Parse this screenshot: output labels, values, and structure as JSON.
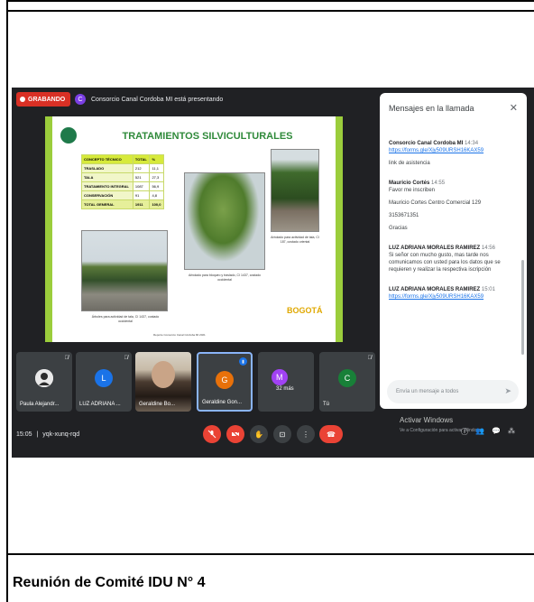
{
  "caption": "Reunión de Comité IDU N° 4",
  "meet": {
    "recording_label": "GRABANDO",
    "presenter_initial": "C",
    "presenting_text": "Consorcio Canal Cordoba MI está presentando",
    "meeting_time": "15:05",
    "meeting_code": "yqk-xunq-rqd",
    "windows_activate": "Activar Windows",
    "windows_activate_sub": "Ve a Configuración para activar Windows."
  },
  "slide": {
    "title": "TRATAMIENTOS SILVICULTURALES",
    "table_headers": [
      "CONCEPTO TÉCNICO",
      "TOTAL",
      "%"
    ],
    "rows": [
      {
        "concept": "TRASLADO",
        "total": "212",
        "pct": "11,1"
      },
      {
        "concept": "TALA",
        "total": "521",
        "pct": "27,3"
      },
      {
        "concept": "TRATAMIENTO INTEGRAL",
        "total": "1087",
        "pct": "56,9"
      },
      {
        "concept": "CONSERVACIÓN",
        "total": "91",
        "pct": "4,8"
      },
      {
        "concept": "TOTAL GENERAL",
        "total": "1911",
        "pct": "100,0"
      }
    ],
    "caption1": "Árboles para actividad de tala, CI 1437, costado occidental",
    "caption2": "Arbolado para bloqueo y traslado, CI 1437, costado occidental",
    "caption3": "Arbolado para actividad de tala, CI 187, costado oriental",
    "logo_text": "BOGOTÁ",
    "footer": "Reporte Consorcio Canal Córdoba MI 2021"
  },
  "chat": {
    "title": "Mensajes en la llamada",
    "messages": [
      {
        "sender": "Consorcio Canal Cordoba MI",
        "time": "14:34",
        "lines": [
          "https://forms.gle/Xjy509URSH16KAX59",
          "link de asistencia"
        ],
        "link_first": true
      },
      {
        "sender": "Mauricio Cortés",
        "time": "14:55",
        "lines": [
          "Favor me inscriben",
          "Mauricio Cortes Centro Comercial 129",
          "3153671351",
          "Gracias"
        ],
        "link_first": false
      },
      {
        "sender": "LUZ ADRIANA MORALES RAMIREZ",
        "time": "14:56",
        "lines": [
          "Si señor con mucho gusto, mas tarde nos comunicamos con usted para los datos que se requieren y realizar la respectiva iscripción"
        ],
        "link_first": false
      },
      {
        "sender": "LUZ ADRIANA MORALES RAMIREZ",
        "time": "15:01",
        "lines": [
          "https://forms.gle/Xjy509URSH16KAX59"
        ],
        "link_first": true
      }
    ],
    "input_placeholder": "Envía un mensaje a todos"
  },
  "participants": [
    {
      "name": "Paula Alejandr...",
      "initial": "",
      "color": "#f2f2f2",
      "type": "avatar-img"
    },
    {
      "name": "LUZ ADRIANA ...",
      "initial": "L",
      "color": "#1a73e8",
      "type": "initial"
    },
    {
      "name": "Geraldine Bo...",
      "initial": "",
      "color": "",
      "type": "photo"
    },
    {
      "name": "Geraldine Gon...",
      "initial": "G",
      "color": "#e8710a",
      "type": "initial"
    },
    {
      "name": "32 más",
      "initial": "M",
      "color": "#a142f4",
      "type": "more"
    },
    {
      "name": "Tú",
      "initial": "C",
      "color": "#188038",
      "type": "initial"
    }
  ],
  "colors": {
    "meet_bg": "#202124",
    "record_red": "#d93025",
    "slide_green": "#9bcd3c",
    "title_green": "#2f8a3a",
    "link_blue": "#1a73e8"
  }
}
